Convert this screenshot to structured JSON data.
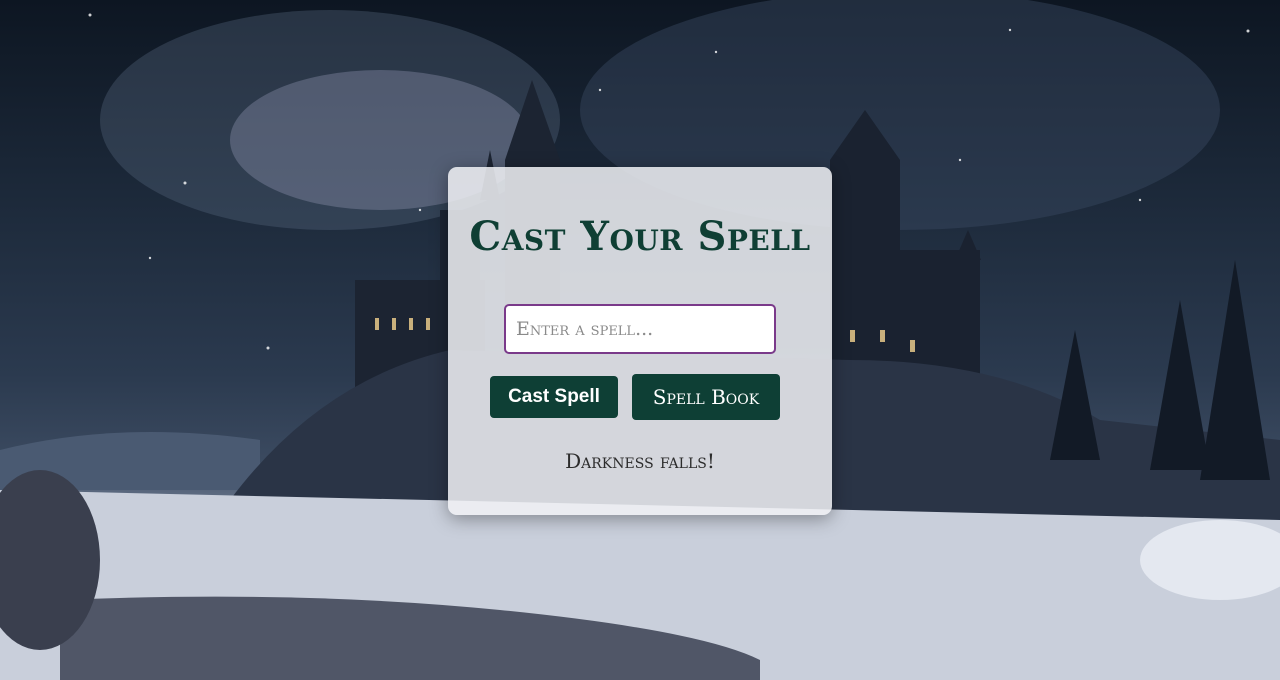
{
  "scene": {
    "description_icon": "castle-night-background"
  },
  "card": {
    "title": "Cast Your Spell",
    "input_placeholder": "Enter a spell...",
    "input_value": "",
    "cast_button_label": "Cast Spell",
    "spellbook_button_label": "Spell Book",
    "status_message": "Darkness falls!"
  },
  "colors": {
    "accent": "#0e3f35",
    "title": "#0f3f34",
    "input_border": "#7a3a8a",
    "card_bg": "#f0f1f4"
  }
}
